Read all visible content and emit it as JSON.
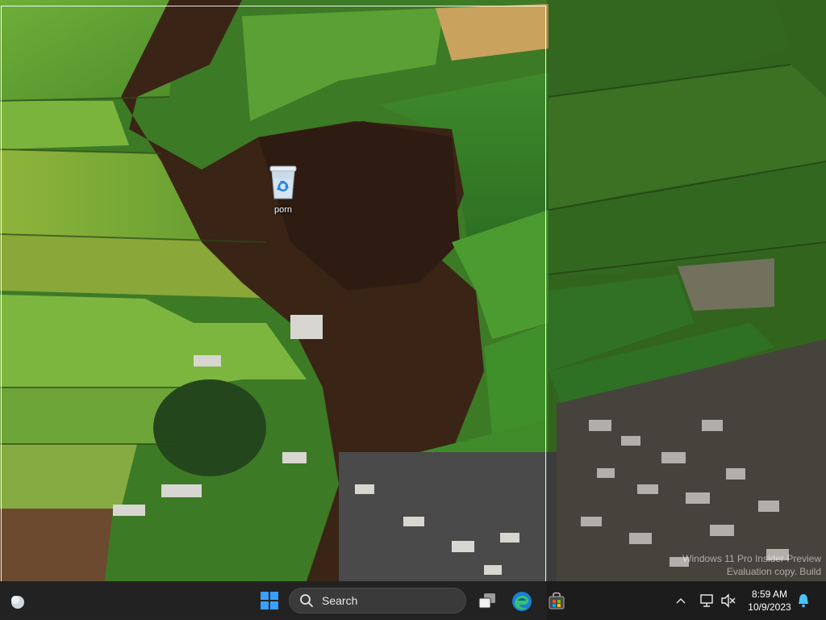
{
  "desktop": {
    "icons": [
      {
        "label": "porn",
        "icon": "recycle-bin-icon"
      }
    ],
    "watermark": {
      "line1": "Windows 11 Pro Insider Preview",
      "line2": "Evaluation copy. Build"
    }
  },
  "taskbar": {
    "search_label": "Search",
    "icons": {
      "weather": "weather-icon",
      "start": "windows-start-icon",
      "task_view": "task-view-icon",
      "edge": "edge-icon",
      "store": "store-icon",
      "chevron": "chevron-up-icon",
      "network": "network-icon",
      "volume": "volume-muted-icon",
      "notifications": "bell-icon"
    },
    "clock": {
      "time": "8:59 AM",
      "date": "10/9/2023"
    }
  },
  "colors": {
    "start_blue": "#3aa0ff",
    "taskbar": "#1c1c1c",
    "notify": "#4cc2ff"
  }
}
